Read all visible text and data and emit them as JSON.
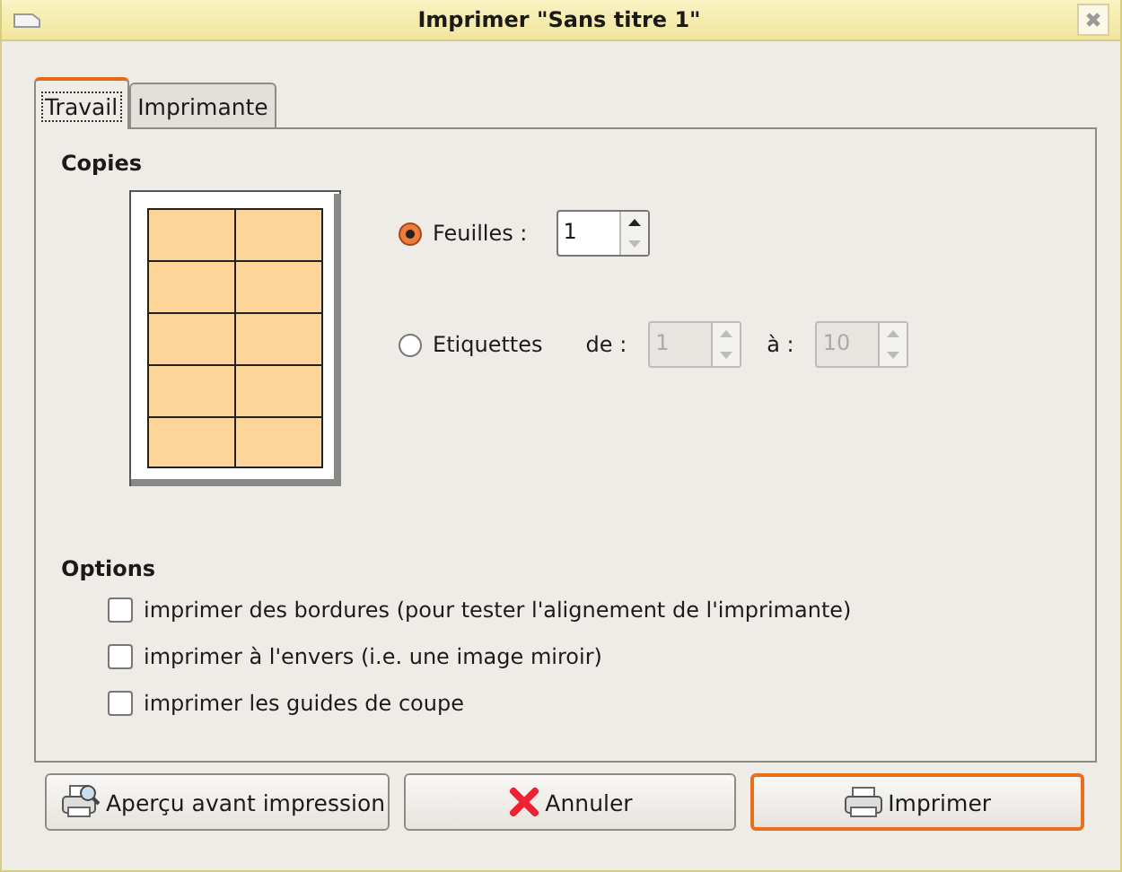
{
  "window": {
    "title": "Imprimer \"Sans titre 1\""
  },
  "tabs": [
    {
      "label": "Travail",
      "selected": true
    },
    {
      "label": "Imprimante",
      "selected": false
    }
  ],
  "copies": {
    "title": "Copies",
    "choices": [
      {
        "label": "Feuilles :",
        "selected": true,
        "fields": [
          {
            "value": "1",
            "disabled": false
          }
        ]
      },
      {
        "label": "Etiquettes",
        "selected": false,
        "fields": [
          {
            "label": "de :",
            "value": "1",
            "disabled": true
          },
          {
            "label": "à :",
            "value": "10",
            "disabled": true
          }
        ]
      }
    ]
  },
  "options": {
    "title": "Options",
    "items": [
      {
        "label": "imprimer des bordures (pour tester l'alignement de l'imprimante)",
        "checked": false
      },
      {
        "label": "imprimer à l'envers (i.e. une image miroir)",
        "checked": false
      },
      {
        "label": "imprimer les guides de coupe",
        "checked": false
      }
    ]
  },
  "buttons": [
    {
      "label": "Aperçu avant impression",
      "kind": "preview",
      "default": false
    },
    {
      "label": "Annuler",
      "kind": "cancel",
      "default": false
    },
    {
      "label": "Imprimer",
      "kind": "print",
      "default": true
    }
  ]
}
